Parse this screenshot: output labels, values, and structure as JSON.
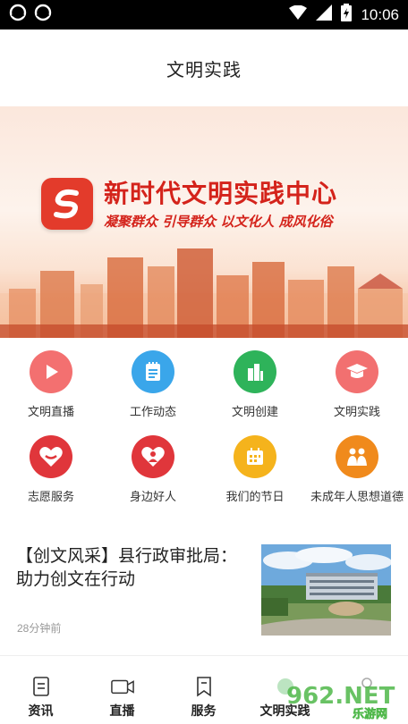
{
  "status_bar": {
    "time": "10:06"
  },
  "header": {
    "title": "文明实践"
  },
  "banner": {
    "title": "新时代文明实践中心",
    "subtitle": "凝聚群众 引导群众 以文化人 成风化俗"
  },
  "grid": {
    "items": [
      {
        "label": "文明直播",
        "icon": "play-icon",
        "color": "#f06b6b"
      },
      {
        "label": "工作动态",
        "icon": "notepad-icon",
        "color": "#3aa6ea"
      },
      {
        "label": "文明创建",
        "icon": "buildings-icon",
        "color": "#2eb35a"
      },
      {
        "label": "文明实践",
        "icon": "graduation-cap-icon",
        "color": "#f27070"
      },
      {
        "label": "志愿服务",
        "icon": "heart-hands-icon",
        "color": "#e0363b"
      },
      {
        "label": "身边好人",
        "icon": "heart-person-icon",
        "color": "#e0363b"
      },
      {
        "label": "我们的节日",
        "icon": "calendar-icon",
        "color": "#f5b31c"
      },
      {
        "label": "未成年人思想道德",
        "icon": "children-icon",
        "color": "#f08a1c"
      }
    ]
  },
  "news": {
    "title": "【创文风采】县行政审批局：助力创文在行动",
    "time": "28分钟前",
    "thumbnail": "government-building-photo"
  },
  "bottom_nav": {
    "items": [
      {
        "label": "资讯",
        "icon": "document-icon"
      },
      {
        "label": "直播",
        "icon": "video-camera-icon"
      },
      {
        "label": "服务",
        "icon": "bookmark-icon"
      },
      {
        "label": "文明实践",
        "icon": "civilization-icon"
      },
      {
        "label": "",
        "icon": "user-icon"
      }
    ]
  },
  "watermark": {
    "text": "962.NET",
    "subtext": "乐游网"
  }
}
